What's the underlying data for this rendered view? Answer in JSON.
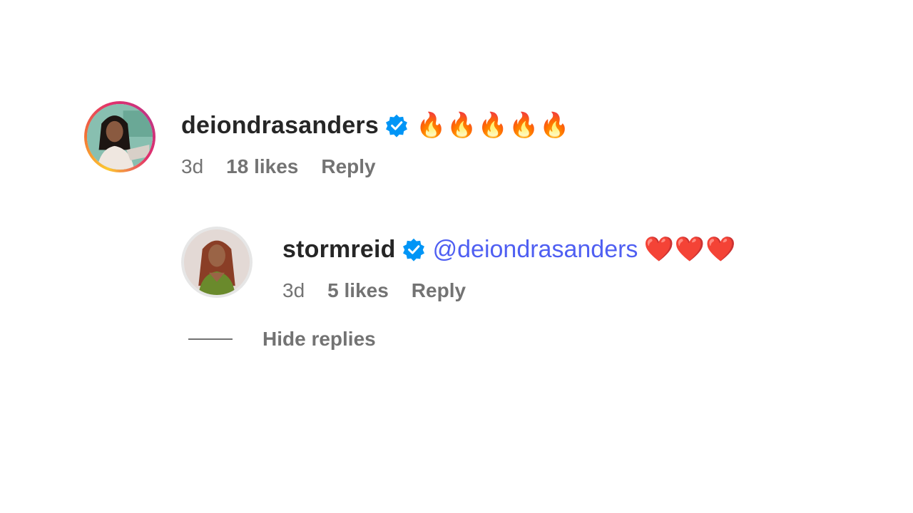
{
  "comments": [
    {
      "username": "deiondrasanders",
      "verified": true,
      "text_emoji": [
        "🔥",
        "🔥",
        "🔥",
        "🔥",
        "🔥"
      ],
      "time": "3d",
      "likes": "18 likes",
      "reply_label": "Reply",
      "avatar_ring": "story-gradient"
    }
  ],
  "replies": [
    {
      "username": "stormreid",
      "verified": true,
      "mention": "@deiondrasanders",
      "text_emoji": [
        "❤️",
        "❤️",
        "❤️"
      ],
      "time": "3d",
      "likes": "5 likes",
      "reply_label": "Reply"
    }
  ],
  "thread": {
    "hide_replies_label": "Hide replies"
  },
  "colors": {
    "username": "#262626",
    "meta": "#737373",
    "mention": "#4f5ff2",
    "verified_badge": "#0095f6"
  },
  "icons": {
    "verified": "verified-badge-icon",
    "fire": "fire-emoji",
    "heart": "red-heart-emoji"
  }
}
